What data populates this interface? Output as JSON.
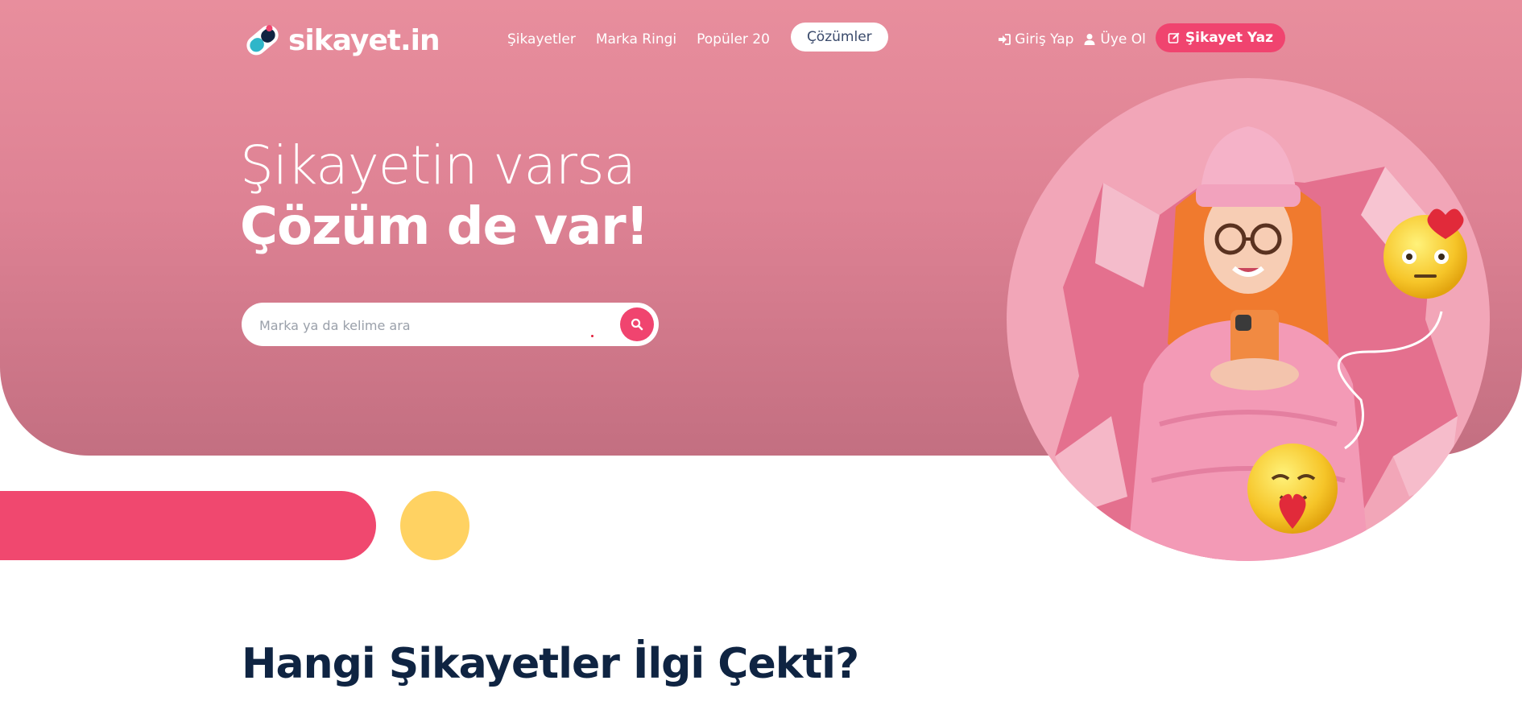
{
  "header": {
    "logo_text": "sikayet.in",
    "nav": [
      {
        "label": "Şikayetler"
      },
      {
        "label": "Marka Ringi"
      },
      {
        "label": "Popüler 20"
      }
    ],
    "solutions_label": "Çözümler",
    "login_label": "Giriş Yap",
    "register_label": "Üye Ol",
    "cta_label": "Şikayet Yaz"
  },
  "hero": {
    "headline_light": "Şikayetin varsa",
    "headline_bold": "Çözüm de var!",
    "search_placeholder": "Marka ya da kelime ara",
    "image": "woman-with-phone-and-emoji-illustration"
  },
  "section": {
    "title": "Hangi Şikayetler İlgi Çekti?"
  },
  "colors": {
    "hero_pink": "#e88e9d",
    "accent": "#f0446f",
    "yellow": "#ffd262",
    "navy": "#0f2442"
  },
  "icons": {
    "login": "sign-in-icon",
    "register": "user-icon",
    "cta": "edit-icon",
    "search": "search-icon"
  }
}
